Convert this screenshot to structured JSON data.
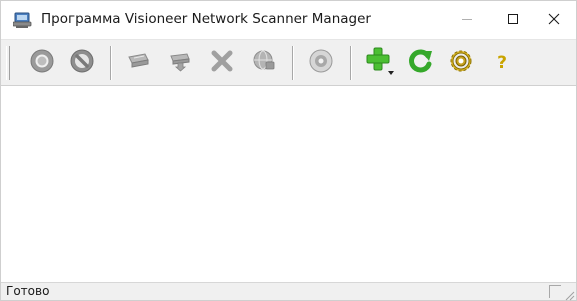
{
  "window": {
    "title": "Программа Visioneer Network Scanner Manager",
    "app_icon": "scanner-app-icon",
    "controls": {
      "minimize_icon": "minimize-icon",
      "maximize_icon": "maximize-icon",
      "close_icon": "close-icon"
    }
  },
  "toolbar": {
    "buttons": [
      {
        "icon": "ring-icon",
        "enabled": false
      },
      {
        "icon": "no-entry-icon",
        "enabled": false
      },
      {
        "icon": "scanner-icon",
        "enabled": false
      },
      {
        "icon": "scanner-down-icon",
        "enabled": false
      },
      {
        "icon": "delete-x-icon",
        "enabled": false
      },
      {
        "icon": "network-globe-icon",
        "enabled": false
      },
      {
        "icon": "disc-icon",
        "enabled": false
      },
      {
        "icon": "add-plus-icon",
        "enabled": true,
        "color": "#3cab2a"
      },
      {
        "icon": "refresh-icon",
        "enabled": true,
        "color": "#35a82a"
      },
      {
        "icon": "settings-gear-icon",
        "enabled": true,
        "color": "#c9a400"
      },
      {
        "icon": "help-icon",
        "enabled": true,
        "glyph": "?",
        "color": "#c9a400"
      }
    ]
  },
  "statusbar": {
    "text": "Готово"
  }
}
